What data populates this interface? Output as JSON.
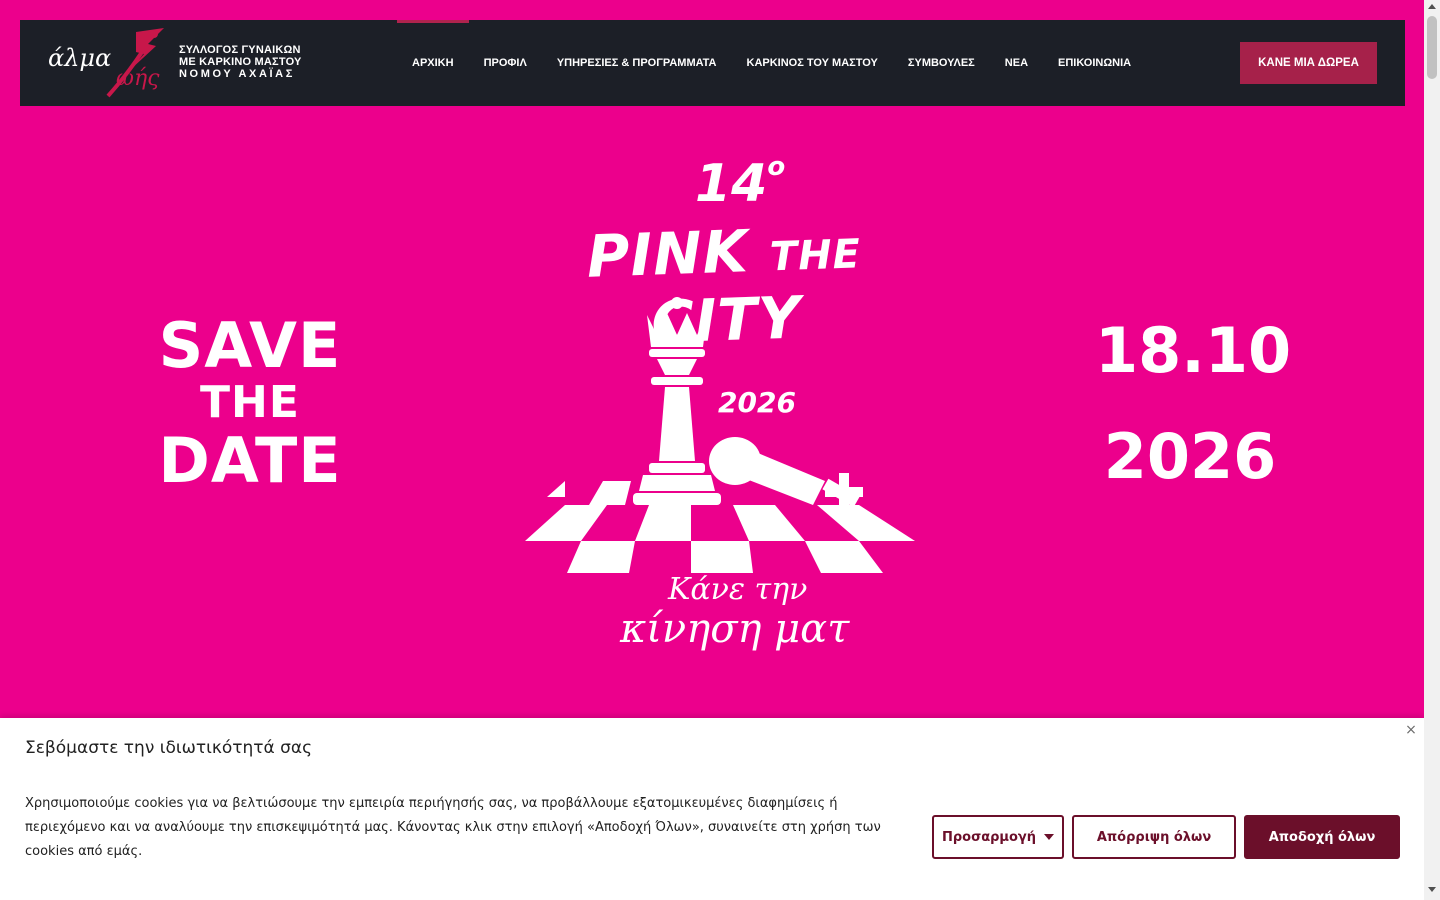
{
  "header": {
    "logo": {
      "word1": "άλμα",
      "word2": "ωής",
      "line1": "ΣΥΛΛΟΓΟΣ ΓΥΝΑΙΚΩΝ",
      "line2": "ΜΕ ΚΑΡΚΙΝΟ ΜΑΣΤΟΥ",
      "line3": "ΝΟΜΟΥ ΑΧΑΪΑΣ"
    },
    "nav": [
      {
        "label": "ΑΡΧΙΚΗ",
        "active": true
      },
      {
        "label": "ΠΡΟΦΙΛ"
      },
      {
        "label": "ΥΠΗΡΕΣΙΕΣ & ΠΡΟΓΡΑΜΜΑΤΑ"
      },
      {
        "label": "ΚΑΡΚΙΝΟΣ ΤΟΥ ΜΑΣΤΟΥ"
      },
      {
        "label": "ΣΥΜΒΟΥΛΕΣ"
      },
      {
        "label": "ΝΕΑ"
      },
      {
        "label": "ΕΠΙΚΟΙΝΩΝΙΑ"
      }
    ],
    "donate_label": "ΚΑΝΕ ΜΙΑ ΔΩΡΕΑ"
  },
  "hero": {
    "save_line1": "SAVE",
    "save_line2": "THE",
    "save_line3": "DATE",
    "edition_number": "14",
    "edition_suffix": "o",
    "title_pink": "PINK",
    "title_the": "THE",
    "title_city": "CITY",
    "year": "2026",
    "slogan_line1": "Κάνε την",
    "slogan_line2": "κίνηση ματ",
    "date_line1": "18.10",
    "date_line2": "2026",
    "background_color": "#ec008c"
  },
  "cookie": {
    "title": "Σεβόμαστε την ιδιωτικότητά σας",
    "text": "Χρησιμοποιούμε cookies για να βελτιώσουμε την εμπειρία περιήγησής σας, να προβάλλουμε εξατομικευμένες διαφημίσεις ή περιεχόμενο και να αναλύουμε την επισκεψιμότητά μας. Κάνοντας κλικ στην επιλογή «Αποδοχή Όλων», συναινείτε στη χρήση των cookies από εμάς.",
    "close_symbol": "×",
    "customize_label": "Προσαρμογή",
    "reject_label": "Απόρριψη όλων",
    "accept_label": "Αποδοχή όλων",
    "accent_color": "#6b0f2a"
  }
}
